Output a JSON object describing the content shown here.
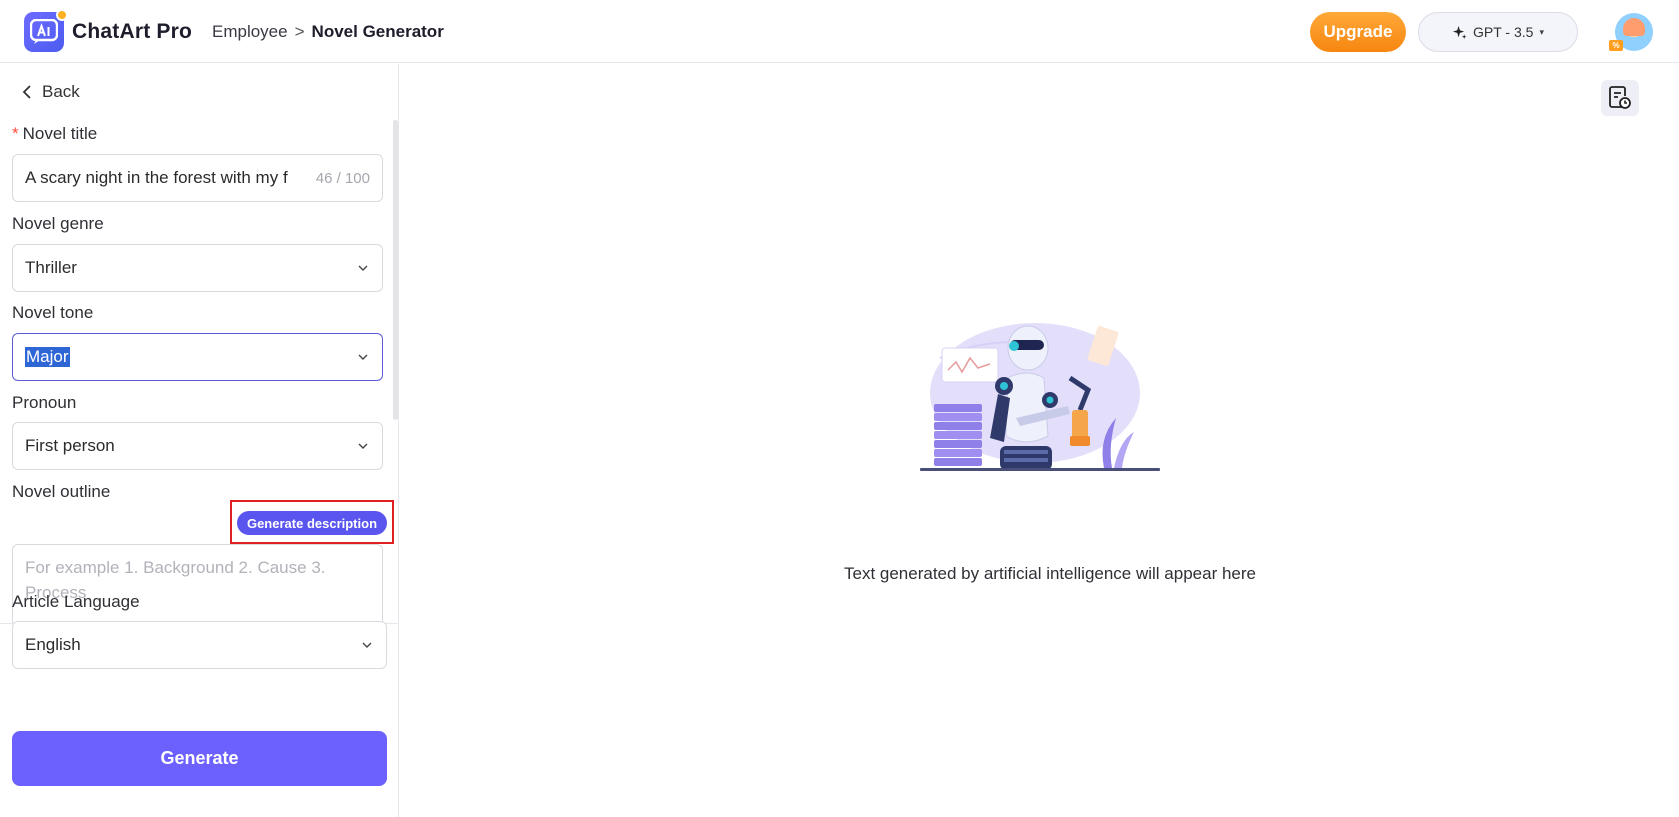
{
  "app": {
    "brand": "ChatArt Pro",
    "breadcrumb": {
      "parent": "Employee",
      "separator": ">",
      "current": "Novel Generator"
    }
  },
  "header": {
    "upgrade_label": "Upgrade",
    "model_label": "GPT - 3.5",
    "model_caret": "▾",
    "avatar_badge": "%"
  },
  "form": {
    "back_label": "Back",
    "required_mark": "*",
    "title": {
      "label": "Novel title",
      "value": "A scary night in the forest with my f",
      "counter": "46 / 100"
    },
    "genre": {
      "label": "Novel genre",
      "value": "Thriller"
    },
    "tone": {
      "label": "Novel tone",
      "value": "Major"
    },
    "pronoun": {
      "label": "Pronoun",
      "value": "First person"
    },
    "outline": {
      "label": "Novel outline",
      "generate_label": "Generate description",
      "placeholder": "For example 1. Background 2. Cause 3. Process"
    },
    "language": {
      "label": "Article Language",
      "value": "English"
    },
    "generate_label": "Generate"
  },
  "output": {
    "empty_message": "Text generated by artificial intelligence will appear here"
  },
  "colors": {
    "accent": "#6c60ff",
    "upgrade": "#f7860f",
    "required": "#ff4d3a",
    "highlight_box": "#e02020"
  },
  "icons": [
    "ai-logo-icon",
    "sparkle-icon",
    "chevron-left-icon",
    "chevron-down-icon",
    "history-icon"
  ]
}
